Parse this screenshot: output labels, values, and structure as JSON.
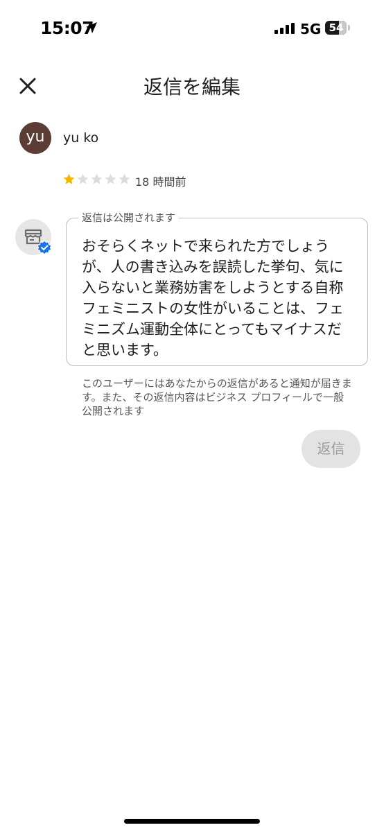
{
  "status_bar": {
    "time": "15:07",
    "network": "5G",
    "battery": "54"
  },
  "header": {
    "title": "返信を編集",
    "close_icon": "close-icon"
  },
  "review": {
    "avatar_initials": "yu",
    "avatar_color": "#5c3d35",
    "reviewer_name": "yu ko",
    "rating": 1,
    "max_rating": 5,
    "star_color": "#f5b400",
    "time_ago": "18 時間前"
  },
  "reply": {
    "legend": "返信は公開されます",
    "text": "おそらくネットで来られた方でしょう\nが、人の書き込みを誤読した挙句、気に\n入らないと業務妨害をしようとする自称\nフェミニストの女性がいることは、フェ\nミニズム運動全体にとってもマイナスだ\nと思います。",
    "notice": "このユーザーにはあなたからの返信があると通知が届きま\nす。また、その返信内容はビジネス プロフィールで一般\n公開されます",
    "button_label": "返信"
  }
}
